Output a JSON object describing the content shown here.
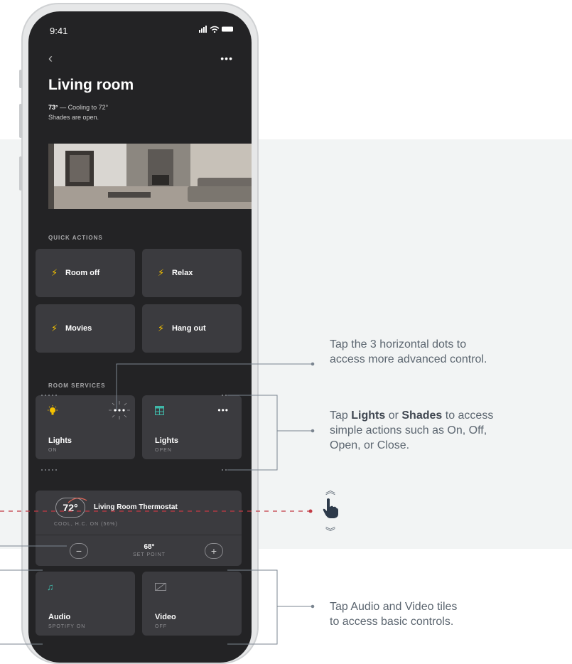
{
  "status": {
    "time": "9:41",
    "icons": "ıl ᯤ ▬"
  },
  "nav": {
    "back": "‹",
    "more": "•••"
  },
  "room": {
    "title": "Living room",
    "temp_value": "73°",
    "temp_text": " — Cooling to 72°",
    "shades": "Shades are open."
  },
  "quick_actions": {
    "label": "QUICK ACTIONS",
    "items": [
      {
        "label": "Room off"
      },
      {
        "label": "Relax"
      },
      {
        "label": "Movies"
      },
      {
        "label": "Hang out"
      }
    ]
  },
  "room_services": {
    "label": "ROOM SERVICES",
    "tiles": [
      {
        "label": "Lights",
        "status": "ON",
        "icon": "lightbulb-icon"
      },
      {
        "label": "Lights",
        "status": "OPEN",
        "icon": "shades-icon"
      }
    ]
  },
  "thermostat": {
    "current": "72°",
    "name": "Living Room Thermostat",
    "status": "COOL, H.C. ON (56%)",
    "setpoint_value": "68°",
    "setpoint_label": "SET POINT",
    "minus": "−",
    "plus": "+"
  },
  "media": [
    {
      "label": "Audio",
      "status": "SPOTIFY ON",
      "icon": "music-note-icon"
    },
    {
      "label": "Video",
      "status": "OFF",
      "icon": "tv-off-icon"
    }
  ],
  "annotations": {
    "dots_line1": "Tap the 3 horizontal dots to",
    "dots_line2": "access more advanced control.",
    "lights_pre": "Tap ",
    "lights_bold1": "Lights",
    "lights_mid": " or ",
    "lights_bold2": "Shades",
    "lights_post": " to access",
    "lights_line2": "simple actions such as On, Off,",
    "lights_line3": "Open, or Close.",
    "av_line1": "Tap Audio and Video tiles",
    "av_line2": "to access basic controls."
  },
  "colors": {
    "accent_bolt": "#f5c200",
    "icon_teal": "#3fb7a8",
    "guide_red": "#c23b45",
    "screen_bg": "#232325",
    "tile_bg": "#3b3b3f"
  }
}
